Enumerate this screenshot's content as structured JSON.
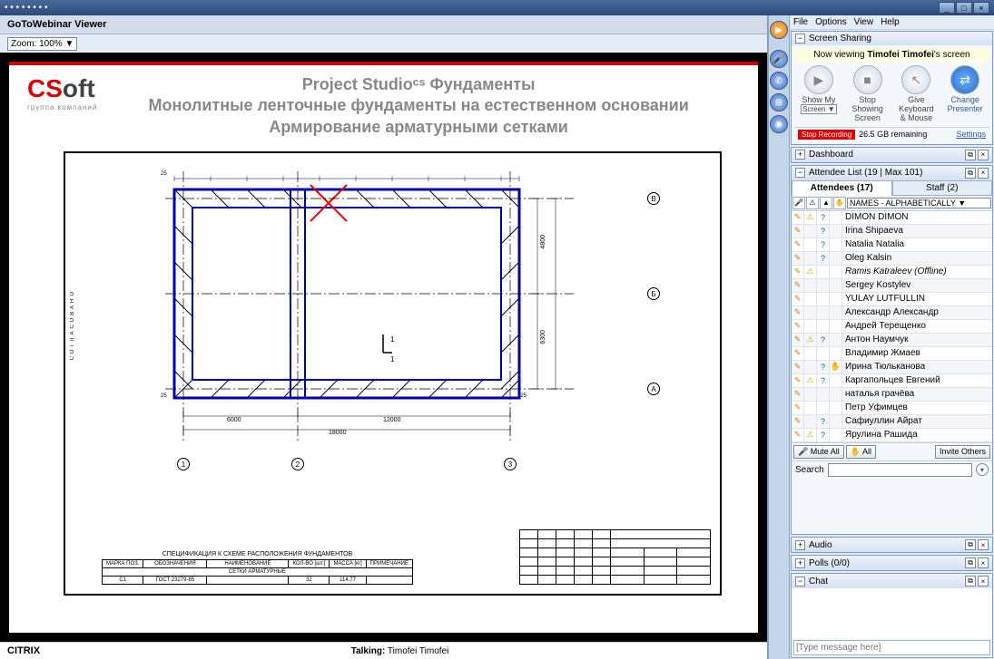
{
  "titlebar": {
    "dots": "• • • • • • • •"
  },
  "viewer": {
    "title": "GoToWebinar Viewer",
    "zoom": "Zoom: 100% ▼",
    "citrix": "CITRIX",
    "talking_label": "Talking:",
    "talking_name": "Timofei Timofei"
  },
  "slide": {
    "logo_c": "CS",
    "logo_s": "oft",
    "logo_sub": "группа компаний",
    "title_l1": "Project Studioᶜˢ Фундаменты",
    "title_l2": "Монолитные ленточные фундаменты на естественном основании",
    "title_l3": "Армирование арматурными сетками",
    "side_label": "СОГЛАСОВАНО",
    "axes_h": [
      "1",
      "2",
      "3"
    ],
    "axes_v": [
      "В",
      "Б",
      "А"
    ],
    "dims": {
      "d6000": "6000",
      "d12000": "12000",
      "d18000": "18000",
      "d4800": "4800",
      "d6300": "6300",
      "d25": "25"
    },
    "spec_title": "СПЕЦИФИКАЦИЯ К СХЕМЕ РАСПОЛОЖЕНИЯ ФУНДАМЕНТОВ",
    "spec_headers": [
      "МАРКА ПОЗ.",
      "ОБОЗНАЧЕНИЯ",
      "НАИМЕНОВАНИЕ",
      "КОЛ-ВО [шт.]",
      "МАССА [кг]",
      "ПРИМЕЧАНИЕ"
    ],
    "spec_section": "СЕТКИ АРМАТУРНЫЕ",
    "spec_row": [
      "С1",
      "ГОСТ 23279-85",
      "",
      "32",
      "114.77",
      ""
    ]
  },
  "menu": {
    "file": "File",
    "options": "Options",
    "view": "View",
    "help": "Help"
  },
  "sharing": {
    "title": "Screen Sharing",
    "now_viewing": "Now viewing ",
    "presenter": "Timofei Timofei",
    "presenter_suffix": "'s screen",
    "show_my": "Show My",
    "screen_sel": "Screen ▼",
    "stop_showing": "Stop Showing Screen",
    "give_kb": "Give Keyboard & Mouse",
    "change_presenter": "Change Presenter",
    "stop_rec": "Stop Recording",
    "remaining": "26.5 GB remaining",
    "settings": "Settings"
  },
  "dashboard": "Dashboard",
  "attendees": {
    "header": "Attendee List  (19 | Max 101)",
    "tab1": "Attendees (17)",
    "tab2": "Staff (2)",
    "sort": "NAMES - ALPHABETICALLY ▼",
    "list": [
      {
        "name": "DIMON DIMON",
        "warn": true,
        "q": true
      },
      {
        "name": "Irina Shipaeva",
        "q": true
      },
      {
        "name": "Natalia Natalia",
        "q": true
      },
      {
        "name": "Oleg Kalsin",
        "q": true
      },
      {
        "name": "Ramis Katraleev (Offline)",
        "warn": true,
        "offline": true
      },
      {
        "name": "Sergey Kostylev"
      },
      {
        "name": "YULAY LUTFULLIN"
      },
      {
        "name": "Александр Александр"
      },
      {
        "name": "Андрей Терещенко"
      },
      {
        "name": "Антон Наумчук",
        "warn": true,
        "q": true
      },
      {
        "name": "Владимир Жмаев"
      },
      {
        "name": "Ирина Тюльканова",
        "q": true,
        "hand": true
      },
      {
        "name": "Каргапольцев Евгений",
        "warn": true,
        "q": true
      },
      {
        "name": "наталья грачёва"
      },
      {
        "name": "Петр Уфимцев"
      },
      {
        "name": "Сафиуллин Айрат",
        "q": true
      },
      {
        "name": "Ярулина Рашида",
        "warn": true,
        "q": true
      }
    ],
    "mute_all": "Mute All",
    "all": "All",
    "invite": "Invite Others",
    "search": "Search"
  },
  "audio": "Audio",
  "polls": "Polls (0/0)",
  "chat": {
    "title": "Chat",
    "placeholder": "[Type message here]"
  }
}
